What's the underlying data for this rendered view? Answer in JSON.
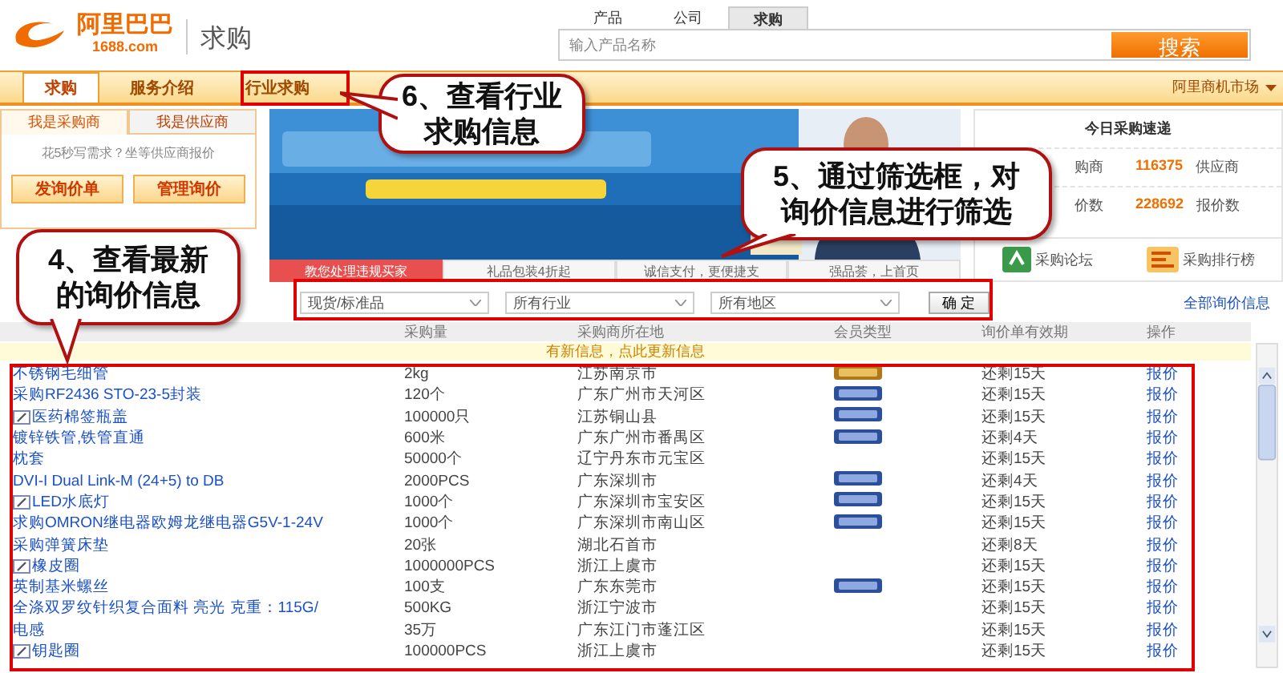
{
  "logo": {
    "name": "阿里巴巴",
    "domain": "1688.com"
  },
  "page_title": "求购",
  "search": {
    "tabs": [
      {
        "label": "产品",
        "selected": false
      },
      {
        "label": "公司",
        "selected": false
      },
      {
        "label": "求购",
        "selected": true
      }
    ],
    "placeholder": "输入产品名称",
    "button": "搜索"
  },
  "nav": {
    "tabs": [
      {
        "label": "求购",
        "selected": true
      },
      {
        "label": "服务介绍",
        "selected": false
      },
      {
        "label": "行业求购",
        "selected": false
      }
    ],
    "market_menu": "阿里商机市场"
  },
  "role_panel": {
    "tabs": [
      {
        "label": "我是采购商",
        "selected": true
      },
      {
        "label": "我是供应商",
        "selected": false
      }
    ],
    "prompt": "花5秒写需求？坐等供应商报价",
    "buttons": [
      "发询价单",
      "管理询价"
    ]
  },
  "banner": {
    "kind": "picture",
    "tabs": [
      {
        "label": "教您处理违规买家",
        "selected": true
      },
      {
        "label": "礼品包装4折起",
        "selected": false
      },
      {
        "label": "诚信支付，更便捷支",
        "selected": false
      },
      {
        "label": "强品荟，上首页",
        "selected": false
      }
    ]
  },
  "today": {
    "title": "今日采购速递",
    "stats": [
      {
        "label": "购商",
        "value": "116375",
        "unit": "供应商"
      },
      {
        "label": "价数",
        "value": "228692",
        "unit": "报价数"
      }
    ],
    "links": [
      "采购论坛",
      "采购排行榜"
    ]
  },
  "filter": {
    "selects": [
      "现货/标准品",
      "所有行业",
      "所有地区"
    ],
    "button": "确 定",
    "all_link": "全部询价信息"
  },
  "table": {
    "columns": [
      "采购量",
      "采购商所在地",
      "会员类型",
      "询价单有效期",
      "操作"
    ],
    "notice": "有新信息，点此更新信息",
    "rows": [
      {
        "kind": "gold",
        "title": "不锈钢毛细管",
        "image": false,
        "quantity": "2kg",
        "location": "江苏南京市",
        "validity": "还剩15天",
        "action": "报价"
      },
      {
        "kind": "member",
        "title": "采购RF2436 STO-23-5封装",
        "image": false,
        "quantity": "120个",
        "location": "广东广州市天河区",
        "validity": "还剩15天",
        "action": "报价"
      },
      {
        "kind": "member",
        "title": "医药棉签瓶盖",
        "image": true,
        "quantity": "100000只",
        "location": "江苏铜山县",
        "validity": "还剩15天",
        "action": "报价"
      },
      {
        "kind": "member",
        "title": "镀锌铁管,铁管直通",
        "image": false,
        "quantity": "600米",
        "location": "广东广州市番禺区",
        "validity": "还剩4天",
        "action": "报价"
      },
      {
        "kind": "plain",
        "title": "枕套",
        "image": false,
        "quantity": "50000个",
        "location": "辽宁丹东市元宝区",
        "validity": "还剩15天",
        "action": "报价"
      },
      {
        "kind": "member",
        "title": "DVI-I Dual Link-M (24+5) to DB",
        "image": false,
        "quantity": "2000PCS",
        "location": "广东深圳市",
        "validity": "还剩4天",
        "action": "报价"
      },
      {
        "kind": "member",
        "title": "LED水底灯",
        "image": true,
        "quantity": "1000个",
        "location": "广东深圳市宝安区",
        "validity": "还剩15天",
        "action": "报价"
      },
      {
        "kind": "member",
        "title": "求购OMRON继电器欧姆龙继电器G5V-1-24V",
        "image": false,
        "quantity": "1000个",
        "location": "广东深圳市南山区",
        "validity": "还剩15天",
        "action": "报价"
      },
      {
        "kind": "plain",
        "title": "采购弹簧床垫",
        "image": false,
        "quantity": "20张",
        "location": "湖北石首市",
        "validity": "还剩8天",
        "action": "报价"
      },
      {
        "kind": "plain",
        "title": "橡皮圈",
        "image": true,
        "quantity": "1000000PCS",
        "location": "浙江上虞市",
        "validity": "还剩15天",
        "action": "报价"
      },
      {
        "kind": "member",
        "title": "英制基米螺丝",
        "image": false,
        "quantity": "100支",
        "location": "广东东莞市",
        "validity": "还剩15天",
        "action": "报价"
      },
      {
        "kind": "plain",
        "title": "全涤双罗纹针织复合面料 亮光 克重：115G/",
        "image": false,
        "quantity": "500KG",
        "location": "浙江宁波市",
        "validity": "还剩15天",
        "action": "报价"
      },
      {
        "kind": "plain",
        "title": "电感",
        "image": false,
        "quantity": "35万",
        "location": "广东江门市蓬江区",
        "validity": "还剩15天",
        "action": "报价"
      },
      {
        "kind": "plain",
        "title": "钥匙圈",
        "image": true,
        "quantity": "100000PCS",
        "location": "浙江上虞市",
        "validity": "还剩15天",
        "action": "报价"
      }
    ]
  },
  "callouts": [
    {
      "text": "6、查看行业求购信息"
    },
    {
      "text": "5、通过筛选框，对询价信息进行筛选"
    },
    {
      "text": "4、查看最新的询价信息"
    }
  ]
}
